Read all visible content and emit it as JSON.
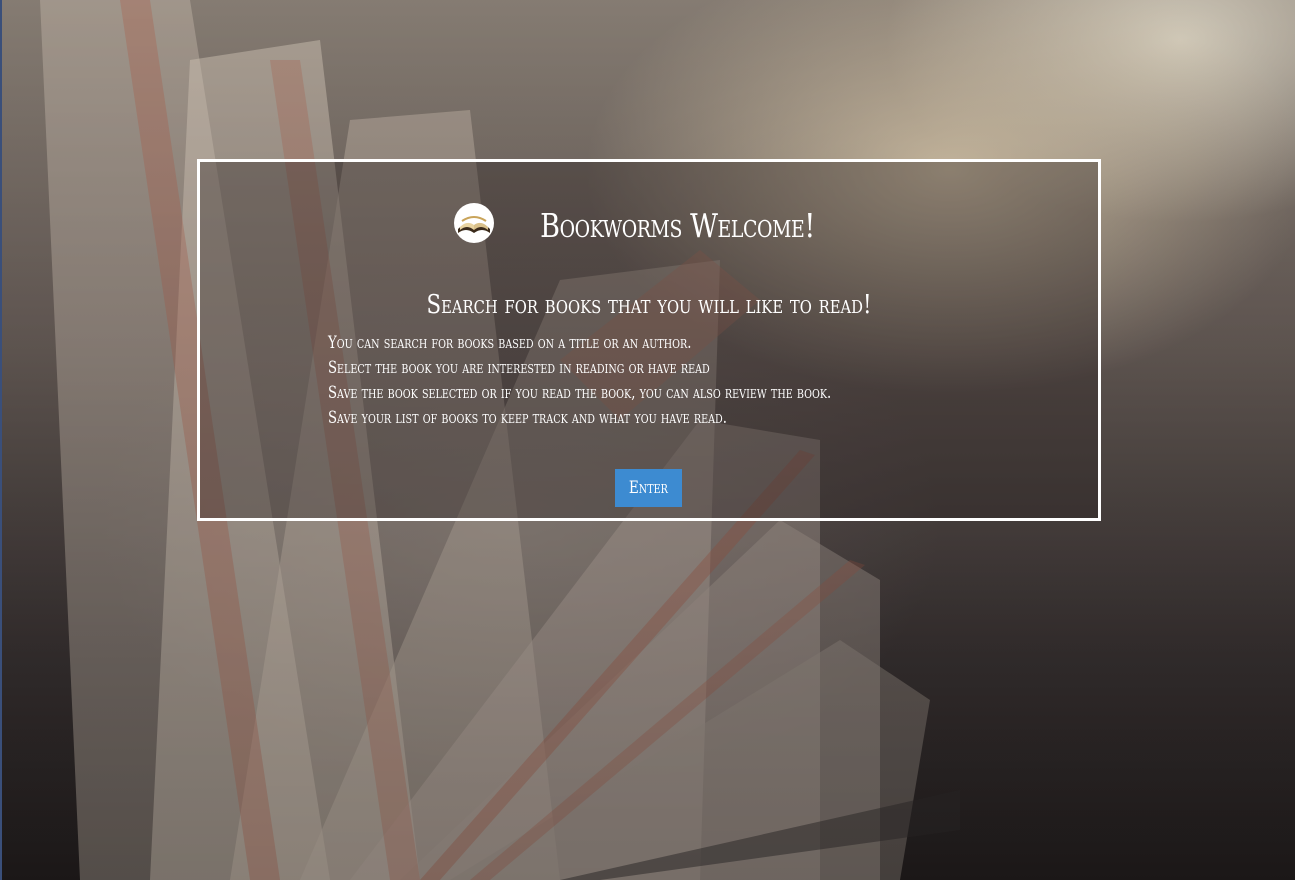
{
  "page": {
    "title": "Bookworms Welcome!",
    "subtitle": "Search for books that you will like to read!"
  },
  "instructions": [
    "You can search for books based on a title or an author.",
    "Select the book you are interested in reading or have read",
    "Save the book selected or if you read the book, you can also review the book.",
    "Save your list of books to keep track and what you have read."
  ],
  "enter_button": {
    "label": "Enter",
    "color": "#3d8bd1"
  },
  "logo": {
    "icon": "open-book-icon"
  },
  "colors": {
    "frame_border": "#ffffff",
    "text": "#ffffff"
  }
}
